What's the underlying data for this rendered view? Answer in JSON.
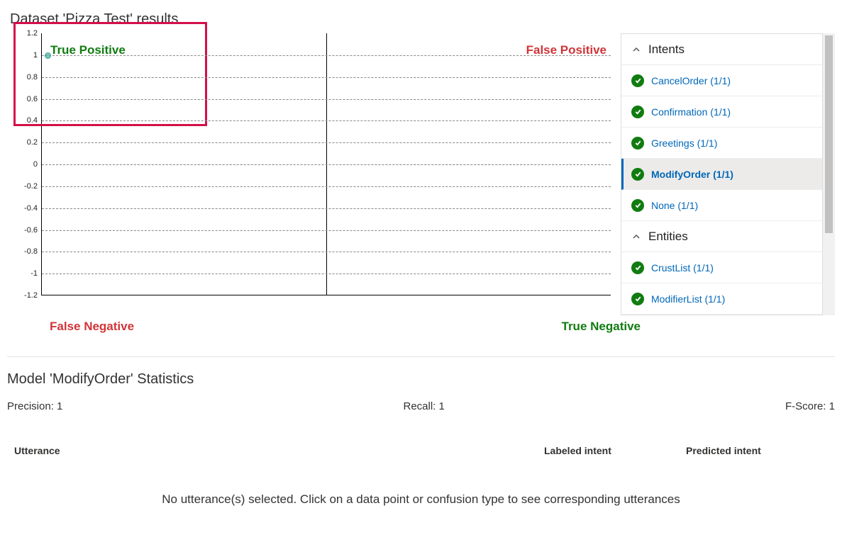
{
  "header": {
    "title": "Dataset 'Pizza Test' results"
  },
  "chart": {
    "quadrant_labels": {
      "tp": "True Positive",
      "fp": "False Positive",
      "fn": "False Negative",
      "tn": "True Negative"
    }
  },
  "sidebar": {
    "sections": [
      {
        "title": "Intents",
        "items": [
          {
            "label": "CancelOrder (1/1)",
            "active": false
          },
          {
            "label": "Confirmation (1/1)",
            "active": false
          },
          {
            "label": "Greetings (1/1)",
            "active": false
          },
          {
            "label": "ModifyOrder (1/1)",
            "active": true
          },
          {
            "label": "None (1/1)",
            "active": false
          }
        ]
      },
      {
        "title": "Entities",
        "items": [
          {
            "label": "CrustList (1/1)",
            "active": false
          },
          {
            "label": "ModifierList (1/1)",
            "active": false
          }
        ]
      }
    ]
  },
  "stats": {
    "title": "Model 'ModifyOrder' Statistics",
    "precision_label": "Precision: 1",
    "recall_label": "Recall: 1",
    "fscore_label": "F-Score: 1"
  },
  "table": {
    "headers": {
      "utterance": "Utterance",
      "labeled": "Labeled intent",
      "predicted": "Predicted intent"
    },
    "empty_message": "No utterance(s) selected. Click on a data point or confusion type to see corresponding utterances"
  },
  "chart_data": {
    "type": "scatter",
    "title": "",
    "xlim": [
      0,
      1
    ],
    "ylim": [
      -1.2,
      1.2
    ],
    "y_ticks": [
      1.2,
      1,
      0.8,
      0.6,
      0.4,
      0.2,
      0,
      -0.2,
      -0.4,
      -0.6,
      -0.8,
      -1,
      -1.2
    ],
    "series": [
      {
        "name": "ModifyOrder",
        "points": [
          {
            "x": 0.01,
            "y": 1
          }
        ]
      }
    ],
    "quadrants": {
      "top_left": "True Positive",
      "top_right": "False Positive",
      "bottom_left": "False Negative",
      "bottom_right": "True Negative"
    },
    "highlight_region": {
      "x0": 0,
      "x1": 0.29,
      "y0": 0.35,
      "y1": 1.25
    }
  }
}
